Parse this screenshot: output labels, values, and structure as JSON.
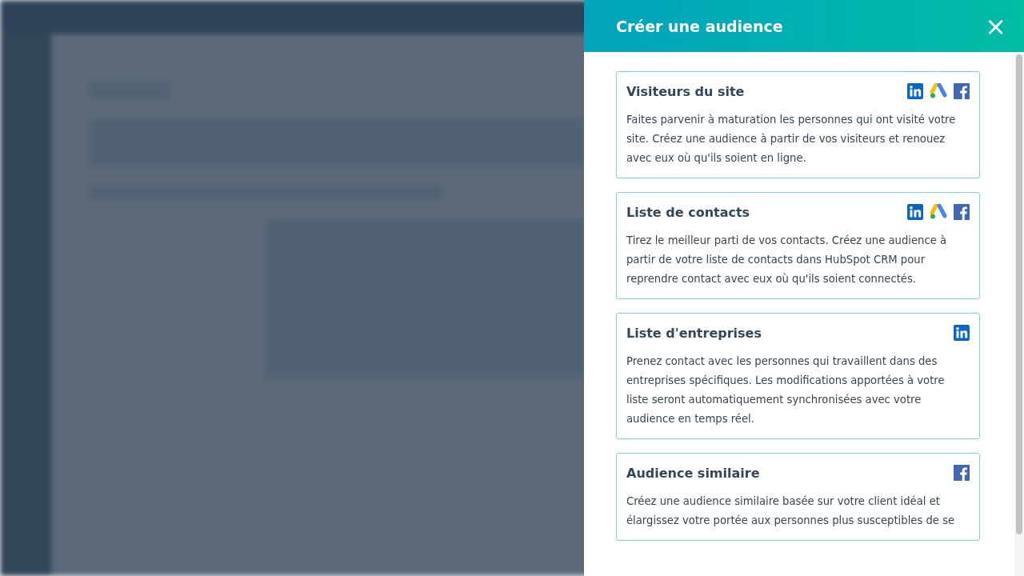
{
  "panel": {
    "title": "Créer une audience",
    "close_label": "×"
  },
  "cards": [
    {
      "title": "Visiteurs du site",
      "networks": [
        {
          "kind": "linkedin"
        },
        {
          "kind": "google_ads"
        },
        {
          "kind": "facebook"
        }
      ],
      "description": "Faites parvenir à maturation les personnes qui ont visité votre site. Créez une audience à partir de vos visiteurs et renouez avec eux où qu'ils soient en ligne."
    },
    {
      "title": "Liste de contacts",
      "networks": [
        {
          "kind": "linkedin"
        },
        {
          "kind": "google_ads"
        },
        {
          "kind": "facebook"
        }
      ],
      "description": "Tirez le meilleur parti de vos contacts. Créez une audience à partir de votre liste de contacts dans HubSpot CRM pour reprendre contact avec eux où qu'ils soient connectés."
    },
    {
      "title": "Liste d'entreprises",
      "networks": [
        {
          "kind": "linkedin"
        }
      ],
      "description": "Prenez contact avec les personnes qui travaillent dans des entreprises spécifiques. Les modifications apportées à votre liste seront automatiquement synchronisées avec votre audience en temps réel."
    },
    {
      "title": "Audience similaire",
      "networks": [
        {
          "kind": "facebook"
        }
      ],
      "description": "Créez une audience similaire basée sur votre client idéal et élargissez votre portée aux personnes plus susceptibles de se"
    }
  ]
}
